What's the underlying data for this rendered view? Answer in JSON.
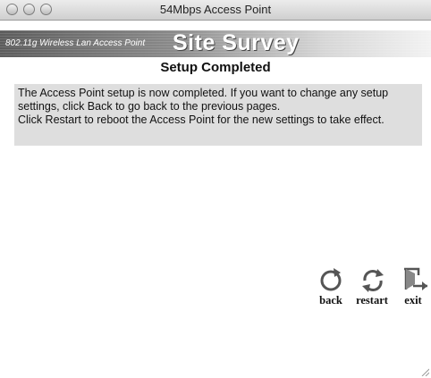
{
  "window": {
    "title": "54Mbps Access Point"
  },
  "banner": {
    "subtitle": "802.11g Wireless Lan Access Point",
    "title": "Site Survey"
  },
  "page": {
    "heading": "Setup Completed",
    "message_lines": [
      "The Access Point setup is now completed. If you want to change any setup settings, click Back to go back to the previous pages.",
      "Click Restart to reboot the Access Point for the new settings to take effect."
    ]
  },
  "nav": {
    "back": "back",
    "restart": "restart",
    "exit": "exit"
  },
  "icons": {
    "back": "back-arrow-icon",
    "restart": "restart-arrows-icon",
    "exit": "exit-door-icon"
  },
  "colors": {
    "message_bg": "#dedede",
    "banner_dark": "#5c5c5c"
  }
}
